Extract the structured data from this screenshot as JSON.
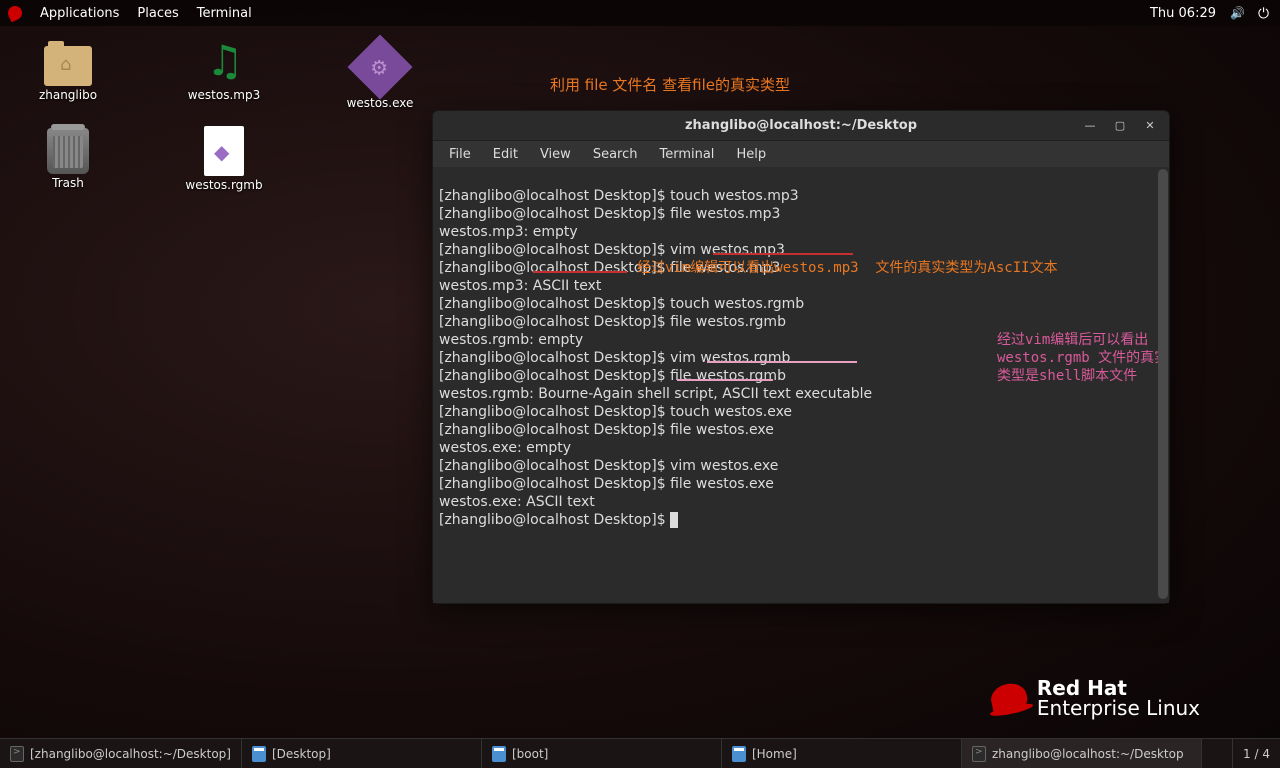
{
  "topbar": {
    "applications": "Applications",
    "places": "Places",
    "terminal": "Terminal",
    "clock": "Thu 06:29"
  },
  "desktop": {
    "icons": [
      {
        "label": "zhanglibo"
      },
      {
        "label": "westos.mp3"
      },
      {
        "label": "westos.exe"
      },
      {
        "label": "Trash"
      },
      {
        "label": "westos.rgmb"
      }
    ]
  },
  "annotation_top": "利用 file  文件名  查看file的真实类型",
  "terminal": {
    "title": "zhanglibo@localhost:~/Desktop",
    "menu": [
      "File",
      "Edit",
      "View",
      "Search",
      "Terminal",
      "Help"
    ],
    "prompt": "[zhanglibo@localhost Desktop]$ ",
    "lines": [
      "[zhanglibo@localhost Desktop]$ touch westos.mp3",
      "[zhanglibo@localhost Desktop]$ file westos.mp3",
      "westos.mp3: empty",
      "[zhanglibo@localhost Desktop]$ vim westos.mp3",
      "[zhanglibo@localhost Desktop]$ file westos.mp3",
      "westos.mp3: ASCII text",
      "[zhanglibo@localhost Desktop]$ touch westos.rgmb",
      "[zhanglibo@localhost Desktop]$ file westos.rgmb",
      "westos.rgmb: empty",
      "[zhanglibo@localhost Desktop]$ vim westos.rgmb",
      "[zhanglibo@localhost Desktop]$ file westos.rgmb",
      "westos.rgmb: Bourne-Again shell script, ASCII text executable",
      "[zhanglibo@localhost Desktop]$ touch westos.exe",
      "[zhanglibo@localhost Desktop]$ file westos.exe",
      "westos.exe: empty",
      "[zhanglibo@localhost Desktop]$ vim westos.exe",
      "[zhanglibo@localhost Desktop]$ file westos.exe",
      "westos.exe: ASCII text"
    ],
    "annotation_mp3": "经过vim编辑可以看出westos.mp3  文件的真实类型为AscII文本",
    "annotation_rgmb": "经过vim编辑后可以看出\nwestos.rgmb 文件的真实\n类型是shell脚本文件"
  },
  "brand": {
    "top": "Red Hat",
    "bottom": "Enterprise Linux"
  },
  "taskbar": {
    "items": [
      "[zhanglibo@localhost:~/Desktop]",
      "[Desktop]",
      "[boot]",
      "[Home]",
      "zhanglibo@localhost:~/Desktop"
    ],
    "counter": "1 / 4"
  }
}
